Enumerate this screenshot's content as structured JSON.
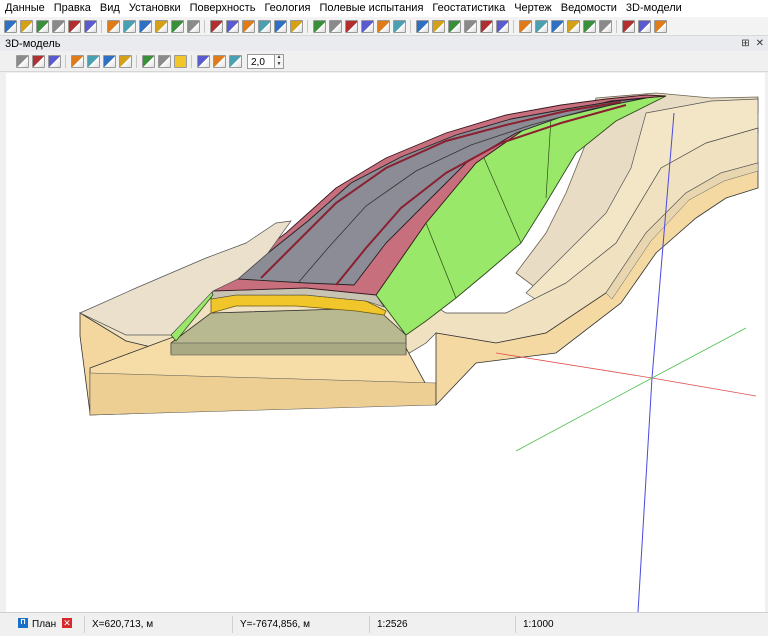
{
  "menu": [
    "Данные",
    "Правка",
    "Вид",
    "Установки",
    "Поверхность",
    "Геология",
    "Полевые испытания",
    "Геостатистика",
    "Чертеж",
    "Ведомости",
    "3D-модели"
  ],
  "panel": {
    "title": "3D-модель",
    "pin_glyph": "⊞",
    "close_glyph": "✕"
  },
  "toolbar2": {
    "zoom_value": "2,0",
    "up_glyph": "▲",
    "down_glyph": "▼"
  },
  "status": {
    "plan_label": "План",
    "plan_icon_glyph": "П",
    "close_glyph": "✕",
    "x": "X=620,713, м",
    "y": "Y=-7674,856, м",
    "scale1": "1:2526",
    "scale2": "1:1000"
  },
  "colors": {
    "road_gray": "#8c8c96",
    "shoulder_pink": "#c86f7e",
    "slope_green": "#9ae86a",
    "layer_yellow": "#f1c62b",
    "ground_beige": "#f2dfb0",
    "axis_blue": "#4a4ae0",
    "axis_red": "#e05050",
    "axis_green": "#50c050"
  },
  "icons": {
    "toolbar": [
      "new-icon",
      "open-icon",
      "save-icon",
      "print-icon",
      "zoom-in-icon",
      "zoom-out-icon",
      "zoom-window-icon",
      "pan-icon",
      "fit-icon",
      "layers-icon",
      "grid-icon",
      "move-icon",
      "rotate-icon",
      "measure-icon",
      "pencil-icon",
      "undo-icon",
      "redo-icon",
      "table-icon",
      "tools-icon",
      "info-icon",
      "delete-icon",
      "frame-icon",
      "page-icon",
      "stamp-icon",
      "export-icon",
      "palette-icon",
      "copy-icon",
      "paste-icon",
      "green-square-icon",
      "pointer-icon",
      "target-icon",
      "arrow-icon",
      "split-icon",
      "join-icon",
      "window-icon",
      "tile-icon",
      "cascade-icon",
      "arrange-icon",
      "panel-icon"
    ],
    "toolbar2": [
      "rotate-icon",
      "view-icon",
      "monitor-icon",
      "axis-z-icon",
      "axis-x-icon",
      "axis-y-icon",
      "axis-v-icon",
      "layers-icon",
      "surface-icon",
      "solid-icon",
      "wire-icon",
      "texture-icon",
      "light-icon"
    ]
  }
}
